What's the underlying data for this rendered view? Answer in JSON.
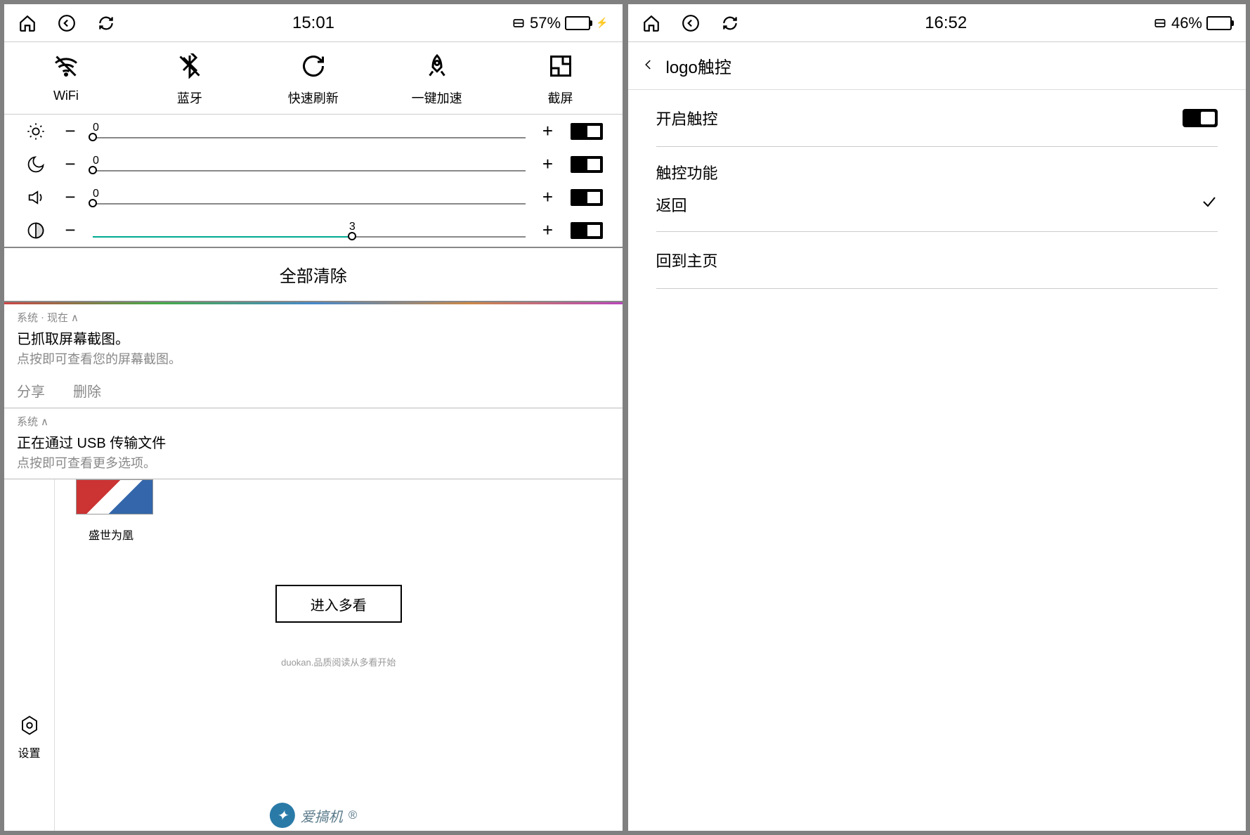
{
  "left": {
    "status": {
      "time": "15:01",
      "battery_pct": "57%",
      "battery_fill": 57,
      "charging": true
    },
    "tiles": [
      {
        "id": "wifi",
        "label": "WiFi"
      },
      {
        "id": "bluetooth",
        "label": "蓝牙"
      },
      {
        "id": "refresh",
        "label": "快速刷新"
      },
      {
        "id": "boost",
        "label": "一键加速"
      },
      {
        "id": "screenshot",
        "label": "截屏"
      }
    ],
    "sliders": [
      {
        "id": "brightness",
        "value": 0,
        "pct": 0,
        "accent": false,
        "on": true
      },
      {
        "id": "night",
        "value": 0,
        "pct": 0,
        "accent": false,
        "on": true
      },
      {
        "id": "volume",
        "value": 0,
        "pct": 0,
        "accent": false,
        "on": true
      },
      {
        "id": "contrast",
        "value": 3,
        "pct": 60,
        "accent": true,
        "on": true
      }
    ],
    "clear_all": "全部清除",
    "notifications": [
      {
        "source": "系统",
        "time": "现在",
        "title": "已抓取屏幕截图。",
        "sub": "点按即可查看您的屏幕截图。",
        "actions": [
          "分享",
          "删除"
        ]
      },
      {
        "source": "系统",
        "time": "",
        "title": "正在通过 USB 传输文件",
        "sub": "点按即可查看更多选项。",
        "actions": []
      }
    ],
    "sidebar": {
      "label": "设置"
    },
    "book": {
      "title": "盛世为凰"
    },
    "enter_button": "进入多看",
    "footer": "duokan.品质阅读从多看开始"
  },
  "right": {
    "status": {
      "time": "16:52",
      "battery_pct": "46%",
      "battery_fill": 46,
      "charging": false
    },
    "header": "logo触控",
    "rows": {
      "enable_label": "开启触控",
      "func_label": "触控功能",
      "back_label": "返回",
      "home_label": "回到主页"
    }
  },
  "watermark": "爱搞机"
}
